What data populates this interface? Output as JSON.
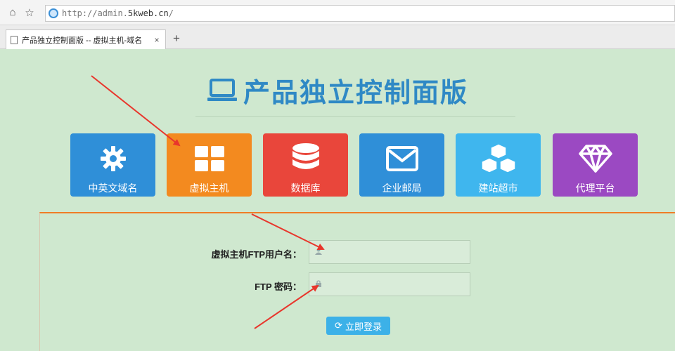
{
  "browser": {
    "url_prefix": "http://admin.",
    "url_domain": "5kweb.cn",
    "url_suffix": "/",
    "tab_title": "产品独立控制面版 -- 虚拟主机-域名",
    "tab_close": "×",
    "new_tab": "+"
  },
  "page": {
    "title": "产品独立控制面版"
  },
  "tiles": [
    {
      "label": "中英文域名",
      "color": "#2f8fd8",
      "icon": "gear-icon"
    },
    {
      "label": "虚拟主机",
      "color": "#f38a1f",
      "icon": "grid-icon"
    },
    {
      "label": "数据库",
      "color": "#e9463b",
      "icon": "database-icon"
    },
    {
      "label": "企业邮局",
      "color": "#2f8fd8",
      "icon": "mail-icon"
    },
    {
      "label": "建站超市",
      "color": "#3fb6ee",
      "icon": "cubes-icon"
    },
    {
      "label": "代理平台",
      "color": "#9b49c2",
      "icon": "diamond-icon"
    }
  ],
  "form": {
    "username_label": "虚拟主机FTP用户名：",
    "password_label": "FTP 密码：",
    "username_value": "",
    "password_value": "",
    "login_label": "立即登录",
    "login_icon": "⟳"
  },
  "colors": {
    "background": "#cfe8cf",
    "title": "#2f89c5",
    "panel_border": "#ef7d27",
    "annotation_arrow": "#e8362c"
  }
}
